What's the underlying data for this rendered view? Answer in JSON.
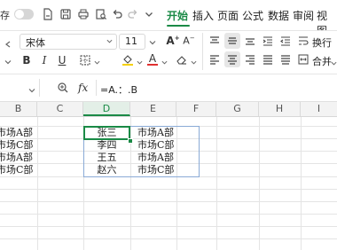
{
  "menubar": {
    "save_label": "存",
    "tabs": [
      "开始",
      "插入",
      "页面",
      "公式",
      "数据",
      "审阅",
      "视图"
    ]
  },
  "ribbon": {
    "font_name": "宋体",
    "font_size": "11",
    "wrap_label": "换行",
    "merge_label": "合并",
    "bold": "B",
    "italic": "I",
    "underline": "U",
    "font_color_letter": "A"
  },
  "formula_bar": {
    "fx_label": "fx",
    "formula": "=A.：.B"
  },
  "columns": [
    "B",
    "C",
    "D",
    "E",
    "F",
    "G",
    "H",
    "I"
  ],
  "selected_column": "D",
  "sheet": {
    "col_b": [
      "市场A部",
      "市场C部",
      "市场A部",
      "市场C部"
    ],
    "col_d": [
      "张三",
      "李四",
      "王五",
      "赵六"
    ],
    "col_e": [
      "市场A部",
      "市场C部",
      "市场A部",
      "市场C部"
    ]
  },
  "colors": {
    "accent": "#1a8a46",
    "selection_border": "#8aaad6",
    "font_color_bar": "#e03030",
    "highlight_bar": "#f5d000"
  }
}
